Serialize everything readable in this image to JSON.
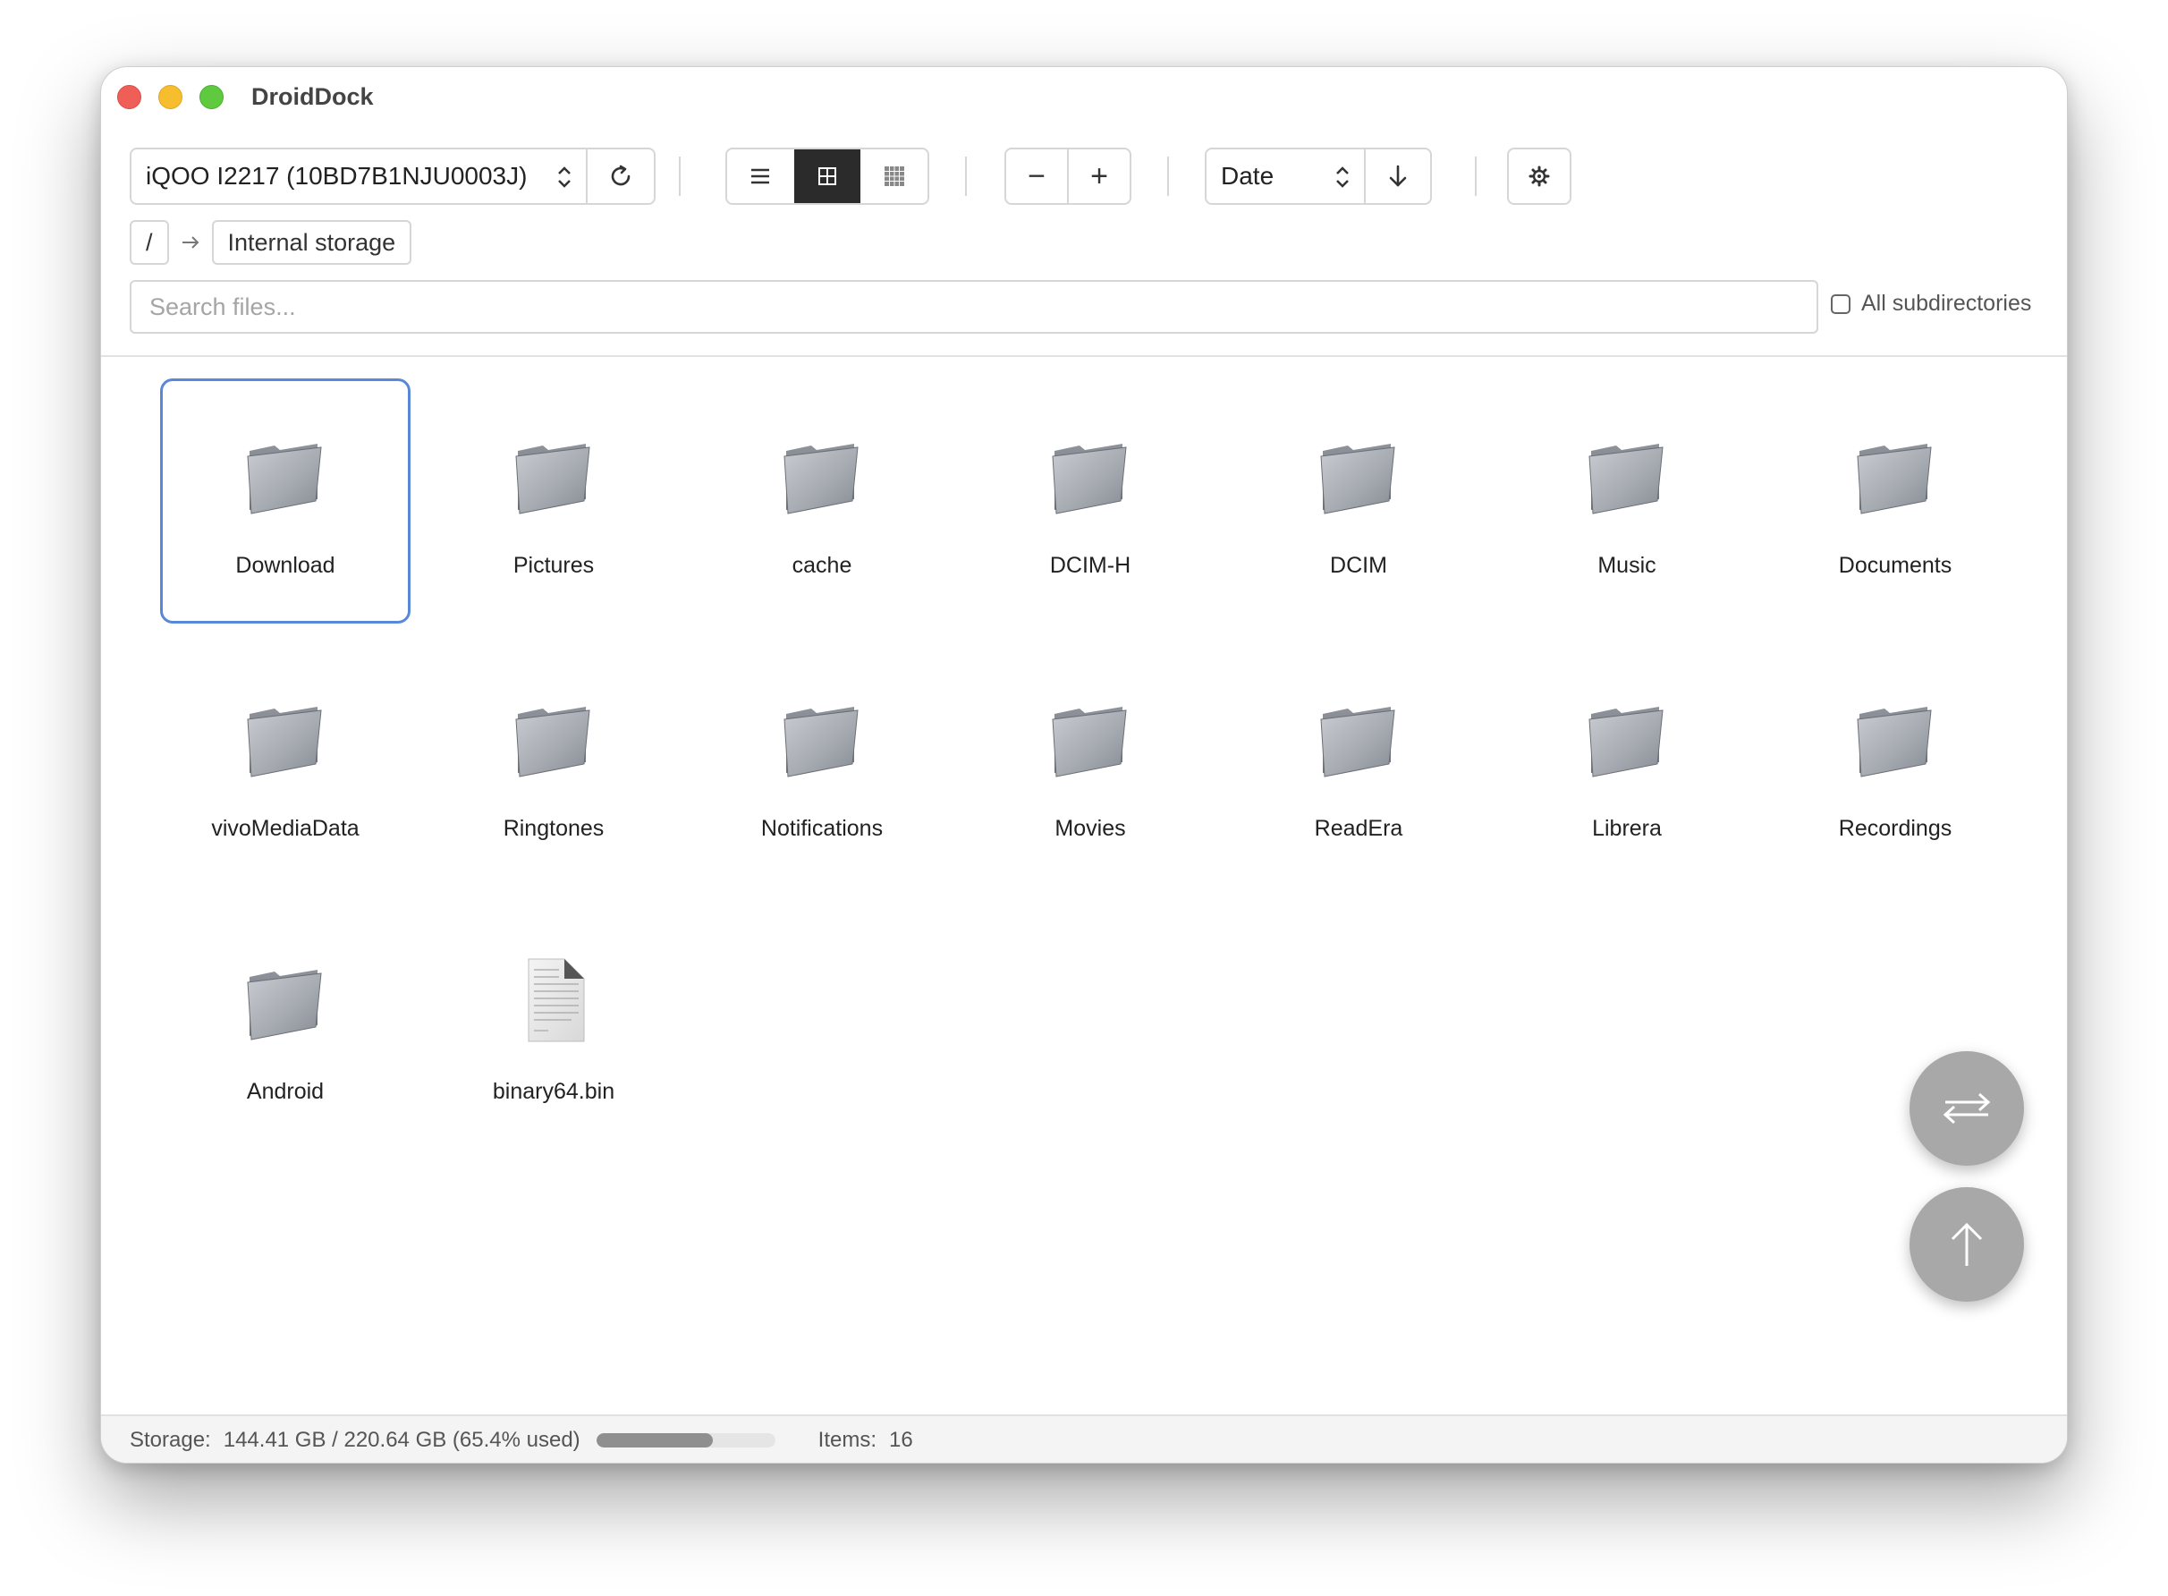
{
  "window": {
    "title": "DroidDock"
  },
  "toolbar": {
    "device": "iQOO I2217 (10BD7B1NJU0003J)",
    "refresh_icon": "refresh-icon",
    "view_modes": [
      "list",
      "grid",
      "compact-grid"
    ],
    "active_view": "grid",
    "zoom_out_label": "−",
    "zoom_in_label": "+",
    "sort": "Date",
    "sort_direction_icon": "arrow-down-icon",
    "settings_icon": "gear-icon"
  },
  "breadcrumb": {
    "root": "/",
    "current": "Internal storage"
  },
  "search": {
    "placeholder": "Search files...",
    "value": "",
    "subdirs_label": "All subdirectories",
    "subdirs_checked": false
  },
  "files": [
    {
      "name": "Download",
      "type": "folder",
      "selected": true
    },
    {
      "name": "Pictures",
      "type": "folder"
    },
    {
      "name": "cache",
      "type": "folder"
    },
    {
      "name": "DCIM-H",
      "type": "folder"
    },
    {
      "name": "DCIM",
      "type": "folder"
    },
    {
      "name": "Music",
      "type": "folder"
    },
    {
      "name": "Documents",
      "type": "folder"
    },
    {
      "name": "vivoMediaData",
      "type": "folder"
    },
    {
      "name": "Ringtones",
      "type": "folder"
    },
    {
      "name": "Notifications",
      "type": "folder"
    },
    {
      "name": "Movies",
      "type": "folder"
    },
    {
      "name": "ReadEra",
      "type": "folder"
    },
    {
      "name": "Librera",
      "type": "folder"
    },
    {
      "name": "Recordings",
      "type": "folder"
    },
    {
      "name": "Android",
      "type": "folder"
    },
    {
      "name": "binary64.bin",
      "type": "file"
    }
  ],
  "status": {
    "storage_label": "Storage:",
    "storage_value": "144.41 GB / 220.64 GB (65.4% used)",
    "used_fraction": 0.654,
    "items_label": "Items:",
    "items_value": "16"
  },
  "fabs": {
    "swap_icon": "swap-arrows-icon",
    "up_icon": "arrow-up-icon"
  }
}
